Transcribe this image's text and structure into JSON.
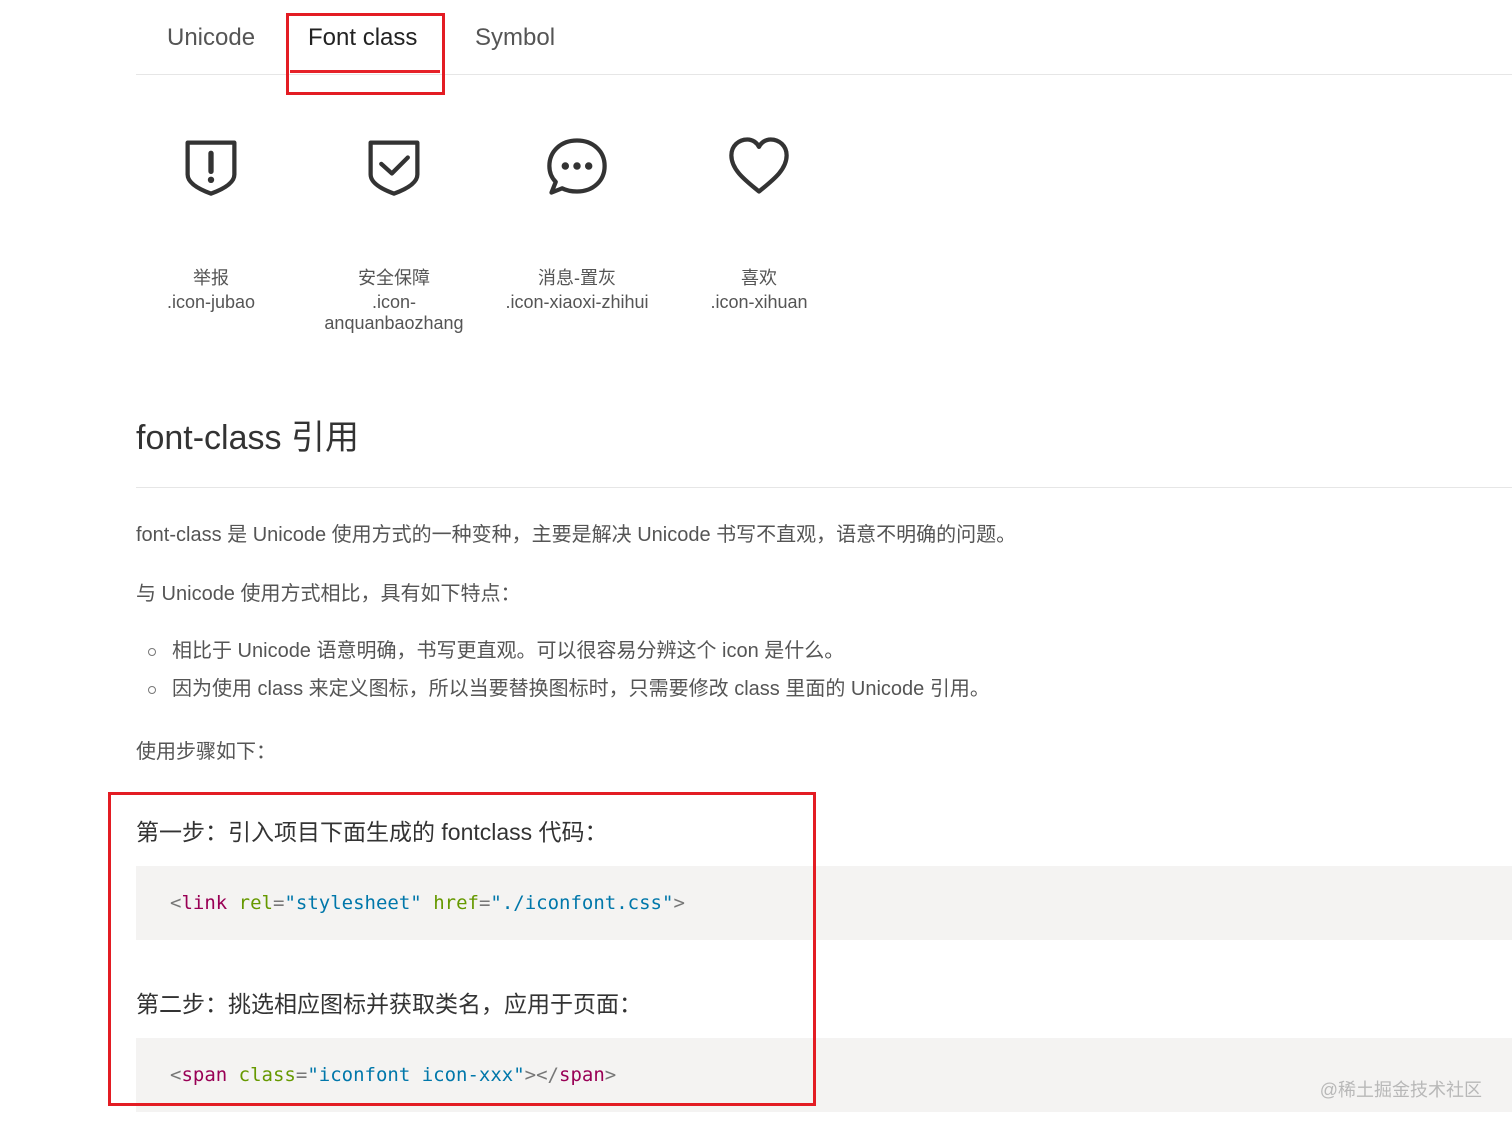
{
  "tabs": [
    {
      "label": "Unicode"
    },
    {
      "label": "Font class"
    },
    {
      "label": "Symbol"
    }
  ],
  "icons": [
    {
      "name": "举报",
      "class_name": ".icon-jubao",
      "icon": "alert-shield-icon"
    },
    {
      "name": "安全保障",
      "class_name": ".icon-anquanbaozhang",
      "class_line1": ".icon-",
      "class_line2": "anquanbaozhang",
      "icon": "check-shield-icon"
    },
    {
      "name": "消息-置灰",
      "class_name": ".icon-xiaoxi-zhihui",
      "icon": "message-bubble-icon"
    },
    {
      "name": "喜欢",
      "class_name": ".icon-xihuan",
      "icon": "heart-icon"
    }
  ],
  "section": {
    "title": "font-class 引用",
    "intro": "font-class 是 Unicode 使用方式的一种变种，主要是解决 Unicode 书写不直观，语意不明确的问题。",
    "compare": "与 Unicode 使用方式相比，具有如下特点：",
    "features": [
      "相比于 Unicode 语意明确，书写更直观。可以很容易分辨这个 icon 是什么。",
      "因为使用 class 来定义图标，所以当要替换图标时，只需要修改 class 里面的 Unicode 引用。"
    ],
    "steps_intro": "使用步骤如下：",
    "step1": "第一步：引入项目下面生成的 fontclass 代码：",
    "code1": {
      "lt": "<",
      "tag": "link",
      "attr1": "rel",
      "eq": "=",
      "val1": "\"stylesheet\"",
      "attr2": "href",
      "val2": "\"./iconfont.css\"",
      "gt": ">"
    },
    "step2": "第二步：挑选相应图标并获取类名，应用于页面：",
    "code2": {
      "lt": "<",
      "tag": "span",
      "attr1": "class",
      "eq": "=",
      "val1": "\"iconfont icon-xxx\"",
      "mid": "></",
      "gt": ">"
    }
  },
  "watermark": "@稀土掘金技术社区",
  "colors": {
    "highlight_box": "#e31c23",
    "code_bg": "#f4f3f2"
  }
}
